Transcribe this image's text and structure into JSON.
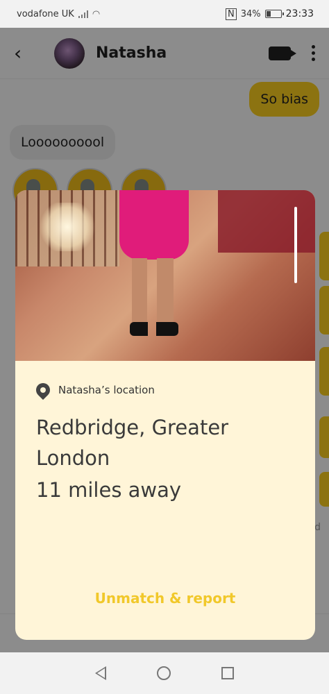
{
  "status_bar": {
    "carrier": "vodafone UK",
    "battery": "34%",
    "time": "23:33",
    "battery_level": 0.34
  },
  "chat": {
    "contact_name": "Natasha",
    "messages": [
      {
        "direction": "out",
        "text": "So bias"
      },
      {
        "direction": "in",
        "text": "Loooooooool"
      }
    ],
    "partial_side_text": "d"
  },
  "modal": {
    "location_label": "Natasha’s location",
    "place": "Redbridge, Greater London",
    "distance": "11 miles away",
    "report_label": "Unmatch & report",
    "accent_color": "#f1c82a",
    "background_color": "#fff5d8"
  },
  "icons": {
    "back": "back-arrow-icon",
    "video": "video-call-icon",
    "more": "more-vertical-icon",
    "pin": "location-pin-icon"
  }
}
